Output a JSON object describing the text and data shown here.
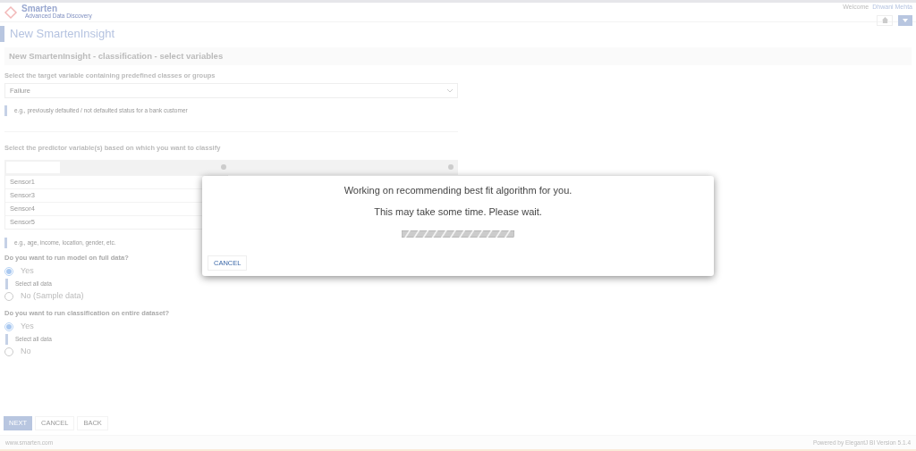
{
  "header": {
    "logo_name": "Smarten",
    "logo_tagline": "Advanced Data Discovery",
    "welcome": "Welcome",
    "user": "Dhwani Mehta"
  },
  "page_title": "New SmartenInsight",
  "section_title": "New SmartenInsight - classification - select variables",
  "target": {
    "label": "Select the target variable containing predefined classes or groups",
    "value": "Failure",
    "hint": "e.g., previously defaulted / not defaulted status for a bank customer"
  },
  "predictors": {
    "label": "Select the predictor variable(s) based on which you want to classify",
    "items": [
      "Sensor1",
      "Sensor3",
      "Sensor4",
      "Sensor5"
    ],
    "hint": "e.g., age, income, location, gender, etc."
  },
  "questions": [
    {
      "label": "Do you want to run model on full data?",
      "options": [
        {
          "label": "Yes",
          "selected": true,
          "note": "Select all data"
        },
        {
          "label": "No (Sample data)",
          "selected": false
        }
      ]
    },
    {
      "label": "Do you want to run classification on entire dataset?",
      "options": [
        {
          "label": "Yes",
          "selected": true,
          "note": "Select all data"
        },
        {
          "label": "No",
          "selected": false
        }
      ]
    }
  ],
  "buttons": [
    {
      "label": "NEXT",
      "kind": "primary"
    },
    {
      "label": "CANCEL",
      "kind": "plain"
    },
    {
      "label": "BACK",
      "kind": "plain"
    }
  ],
  "footer": {
    "left": "www.smarten.com",
    "right": "Powered by ElegantJ BI Version 5.1.4"
  },
  "dialog": {
    "lines": [
      "Working on recommending best fit algorithm for you.",
      "This may take some time. Please wait."
    ],
    "button": "CANCEL"
  }
}
